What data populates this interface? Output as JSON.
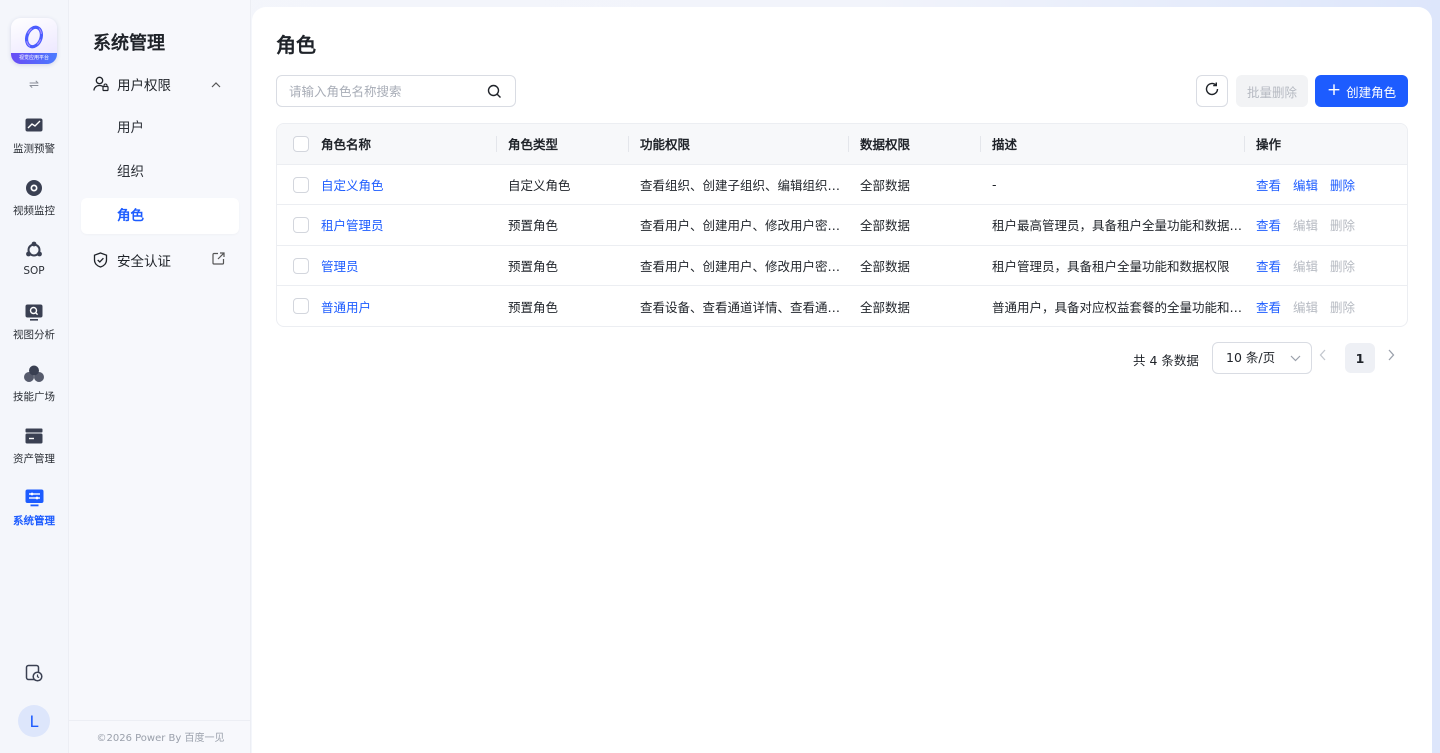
{
  "brand": {
    "logo_caption": "视觉应用平台"
  },
  "rail": {
    "items": [
      {
        "label": "监测预警",
        "icon": "monitor-chart-icon"
      },
      {
        "label": "视频监控",
        "icon": "camera-icon"
      },
      {
        "label": "SOP",
        "icon": "sop-icon"
      },
      {
        "label": "视图分析",
        "icon": "view-analysis-icon"
      },
      {
        "label": "技能广场",
        "icon": "skills-icon"
      },
      {
        "label": "资产管理",
        "icon": "asset-icon"
      },
      {
        "label": "系统管理",
        "icon": "system-icon",
        "active": true
      }
    ],
    "avatar": "L"
  },
  "submenu": {
    "title": "系统管理",
    "group": {
      "label": "用户权限",
      "expanded": true
    },
    "children": [
      "用户",
      "组织",
      "角色"
    ],
    "active": "角色",
    "external": "安全认证",
    "copyright": "©2026 Power By 百度一见"
  },
  "page": {
    "title": "角色",
    "search_placeholder": "请输入角色名称搜索",
    "batch_delete": "批量删除",
    "create": "创建角色"
  },
  "table": {
    "headers": [
      "角色名称",
      "角色类型",
      "功能权限",
      "数据权限",
      "描述",
      "操作"
    ],
    "rows": [
      {
        "name": "自定义角色",
        "type": "自定义角色",
        "func": "查看组织、创建子组织、编辑组织…",
        "data": "全部数据",
        "desc": "-",
        "edit_enabled": true
      },
      {
        "name": "租户管理员",
        "type": "预置角色",
        "func": "查看用户、创建用户、修改用户密…",
        "data": "全部数据",
        "desc": "租户最高管理员，具备租户全量功能和数据…",
        "edit_enabled": false
      },
      {
        "name": "管理员",
        "type": "预置角色",
        "func": "查看用户、创建用户、修改用户密…",
        "data": "全部数据",
        "desc": "租户管理员，具备租户全量功能和数据权限",
        "edit_enabled": false
      },
      {
        "name": "普通用户",
        "type": "预置角色",
        "func": "查看设备、查看通道详情、查看通…",
        "data": "全部数据",
        "desc": "普通用户，具备对应权益套餐的全量功能和…",
        "edit_enabled": false
      }
    ],
    "actions": {
      "view": "查看",
      "edit": "编辑",
      "delete": "删除"
    }
  },
  "pagination": {
    "total": "共 4 条数据",
    "page_size": "10 条/页",
    "current": "1"
  },
  "colors": {
    "accent": "#1d5cff",
    "disabled": "#b6bac2"
  }
}
